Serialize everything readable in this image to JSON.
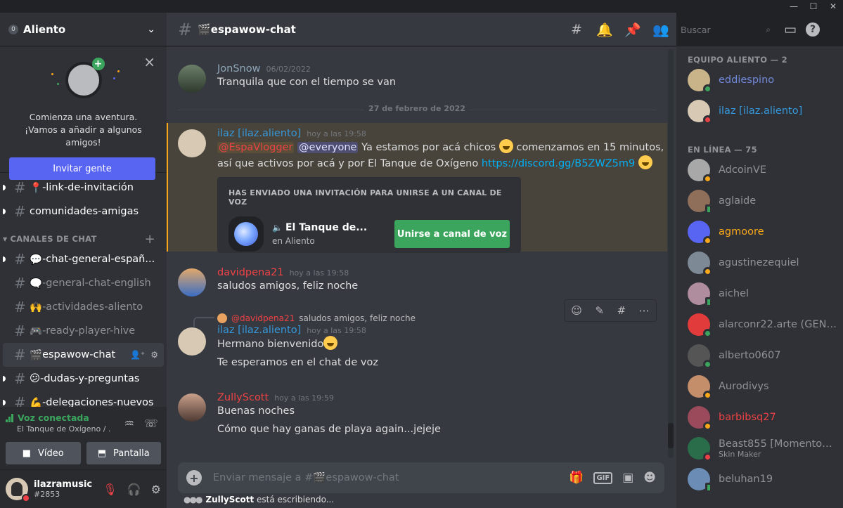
{
  "window": {
    "controls": [
      "—",
      "☐",
      "✕"
    ]
  },
  "server": {
    "badge": "0",
    "name": "Aliento"
  },
  "friend_card": {
    "text_line1": "Comienza una aventura.",
    "text_line2": "¡Vamos a añadir a algunos amigos!",
    "button": "Invitar gente"
  },
  "channels_top": [
    {
      "emoji": "📍",
      "name": "-link-de-invitación",
      "unread": true
    },
    {
      "emoji": "",
      "name": "comunidades-amigas",
      "unread": true
    }
  ],
  "category": {
    "name": "CANALES DE CHAT"
  },
  "channels_chat": [
    {
      "emoji": "💬",
      "name": "-chat-general-españ...",
      "unread": true
    },
    {
      "emoji": "🗨️",
      "name": "-general-chat-english",
      "unread": false
    },
    {
      "emoji": "🙌",
      "name": "-actividades-aliento",
      "unread": false
    },
    {
      "emoji": "🎮",
      "name": "-ready-player-hive",
      "unread": false
    },
    {
      "emoji": "🎬",
      "name": "espawow-chat",
      "active": true
    },
    {
      "emoji": "😕",
      "name": "-dudas-y-preguntas",
      "unread": true
    },
    {
      "emoji": "💪",
      "name": "-delegaciones-nuevos",
      "unread": true
    }
  ],
  "voice": {
    "status": "Voz conectada",
    "channel": "El Tanque de Oxígeno / ...",
    "video_btn": "Vídeo",
    "screen_btn": "Pantalla"
  },
  "user": {
    "name": "ilazramusic",
    "tag": "#2853"
  },
  "header": {
    "channel": "🎬espawow-chat",
    "search_placeholder": "Buscar"
  },
  "messages": {
    "m1": {
      "author": "JonSnow",
      "ts": "06/02/2022",
      "text": "Tranquila que con el tiempo se van",
      "color": "#8fa7b8"
    },
    "divider": "27 de febrero de 2022",
    "m2": {
      "author": "ilaz [ilaz.aliento]",
      "ts": "hoy a las 19:58",
      "color": "#3498db",
      "mention1": "@EspaVlogger",
      "mention2": "@everyone",
      "text1": " Ya estamos por acá chicos ",
      "text2": " comenzamos en 15 minutos,",
      "text3": "así que activos por acá y por El Tanque de Oxígeno ",
      "link": "https://discord.gg/B5ZWZ5m9",
      "invite_head": "HAS ENVIADO UNA INVITACIÓN PARA UNIRSE A UN CANAL DE VOZ",
      "invite_name": "El Tanque de...",
      "invite_sub": "en Aliento",
      "invite_btn": "Unirse a canal de voz"
    },
    "m3": {
      "author": "davidpena21",
      "ts": "hoy a las 19:58",
      "text": "saludos amigos, feliz noche",
      "color": "#ed4245"
    },
    "m4": {
      "reply_author": "@davidpena21",
      "reply_text": "saludos amigos, feliz noche",
      "author": "ilaz [ilaz.aliento]",
      "ts": "hoy a las 19:58",
      "text1": "Hermano bienvenido",
      "text2": "Te esperamos en el chat de voz",
      "color": "#3498db"
    },
    "m5": {
      "author": "ZullyScott",
      "ts": "hoy a las 19:59",
      "text1": "Buenas noches",
      "text2": "Cómo que hay ganas de playa again...jejeje",
      "color": "#ed4245"
    }
  },
  "composer": {
    "placeholder": "Enviar mensaje a #🎬espawow-chat",
    "gif": "GIF"
  },
  "typing": {
    "who": "ZullyScott",
    "rest": " está escribiendo..."
  },
  "members": {
    "group1": "EQUIPO ALIENTO — 2",
    "group2": "EN LÍNEA — 75",
    "team": [
      {
        "name": "eddiespino",
        "color": "#7289da",
        "status": "online",
        "av": "#c9b48a"
      },
      {
        "name": "ilaz [ilaz.aliento]",
        "color": "#3498db",
        "status": "dnd",
        "av": "#d7c9b4"
      }
    ],
    "online": [
      {
        "name": "AdcoinVE",
        "color": "#8e9297",
        "status": "idle",
        "av": "#a8a8a8"
      },
      {
        "name": "aglaide",
        "color": "#8e9297",
        "status": "mobile",
        "av": "#8f6e5a"
      },
      {
        "name": "agmoore",
        "color": "#faa81a",
        "status": "idle",
        "av": "#5865f2"
      },
      {
        "name": "agustinezequiel",
        "color": "#8e9297",
        "status": "idle",
        "av": "#7d8a96"
      },
      {
        "name": "aichel",
        "color": "#8e9297",
        "status": "mobile",
        "av": "#b08d9e"
      },
      {
        "name": "alarconr22.arte (GENE...",
        "color": "#8e9297",
        "status": "online",
        "av": "#e23b3b"
      },
      {
        "name": "alberto0607",
        "color": "#8e9297",
        "status": "online",
        "av": "#555"
      },
      {
        "name": "Aurodivys",
        "color": "#8e9297",
        "status": "idle",
        "av": "#c48e6b"
      },
      {
        "name": "barbibsq27",
        "color": "#ed4245",
        "status": "idle",
        "av": "#9a4a5a"
      },
      {
        "name": "Beast855 [Momentos ...",
        "sub": "Skin Maker",
        "color": "#8e9297",
        "status": "dnd",
        "av": "#2a6d4a"
      },
      {
        "name": "beluhan19",
        "color": "#8e9297",
        "status": "mobile",
        "av": "#6b8db5"
      }
    ]
  }
}
